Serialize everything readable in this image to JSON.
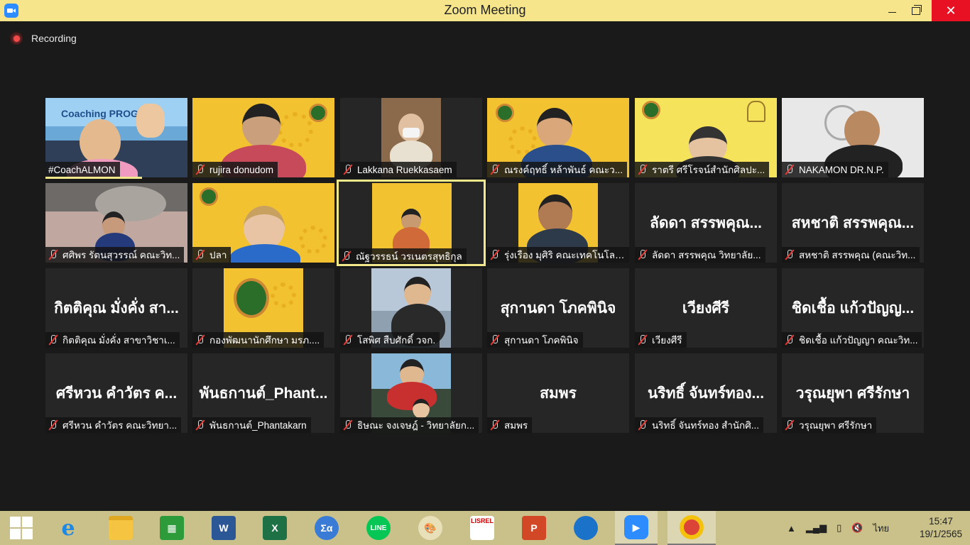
{
  "window": {
    "title": "Zoom Meeting",
    "close_glyph": "✕"
  },
  "recording": {
    "label": "Recording"
  },
  "participants": [
    {
      "name": "#CoachALMON",
      "big": "",
      "muted": false,
      "video": true,
      "overlay": "Coaching PROGRAM"
    },
    {
      "name": "rujira donudom",
      "big": "",
      "muted": true,
      "video": true
    },
    {
      "name": "Lakkana Ruekkasaem",
      "big": "",
      "muted": true,
      "video": true
    },
    {
      "name": "ณรงค์ฤทธิ์ หล้าพันธ์ คณะว...",
      "big": "",
      "muted": true,
      "video": true
    },
    {
      "name": "ราตรี  ศรีโรจน์สำนักศิลปะ...",
      "big": "",
      "muted": true,
      "video": true
    },
    {
      "name": "NAKAMON DR.N.P.",
      "big": "",
      "muted": true,
      "video": true
    },
    {
      "name": "ศศิพร รัตนสุวรรณ์ คณะวิท...",
      "big": "",
      "muted": true,
      "video": true
    },
    {
      "name": "ปลา",
      "big": "",
      "muted": true,
      "video": true
    },
    {
      "name": "ณัฐวรรธน์ วรเนตรสุทธิกุล",
      "big": "",
      "muted": true,
      "video": true
    },
    {
      "name": "รุ่งเรือง มุศิริ คณะเทคโนโลย...",
      "big": "",
      "muted": true,
      "video": true
    },
    {
      "name": "ลัดดา สรรพคุณ  วิทยาลัย...",
      "big": "ลัดดา สรรพคุณ...",
      "muted": true,
      "video": false
    },
    {
      "name": "สหชาติ สรรพคุณ (คณะวิท...",
      "big": "สหชาติ สรรพคุณ...",
      "muted": true,
      "video": false
    },
    {
      "name": "กิตติคุณ  มั่งคั่ง สาขาวิชาเ...",
      "big": "กิตติคุณ  มั่งคั่ง สา...",
      "muted": true,
      "video": false
    },
    {
      "name": "กองพัฒนานักศึกษา มรภ....",
      "big": "",
      "muted": true,
      "video": true
    },
    {
      "name": "โสพิศ สืบศักดิ์ วจก.",
      "big": "",
      "muted": true,
      "video": true
    },
    {
      "name": "สุกานดา โภคพินิจ",
      "big": "สุกานดา โภคพินิจ",
      "muted": true,
      "video": false
    },
    {
      "name": "เวียงศีรี",
      "big": "เวียงศีรี",
      "muted": true,
      "video": false
    },
    {
      "name": "ชิดเชื้อ แก้วปัญญา คณะวิท...",
      "big": "ชิดเชื้อ แก้วปัญญ...",
      "muted": true,
      "video": false
    },
    {
      "name": "ศรีหวน  คำวัตร คณะวิทยา...",
      "big": "ศรีหวน  คำวัตร ค...",
      "muted": true,
      "video": false
    },
    {
      "name": "พันธกานต์_Phantakarn",
      "big": "พันธกานต์_Phant...",
      "muted": true,
      "video": false
    },
    {
      "name": "ธิษณะ จงเจษฎ์ - วิทยาลัยก...",
      "big": "",
      "muted": true,
      "video": true
    },
    {
      "name": "สมพร",
      "big": "สมพร",
      "muted": true,
      "video": false
    },
    {
      "name": "นริทธิ์ จันทร์ทอง สำนักศิ...",
      "big": "นริทธิ์ จันทร์ทอง...",
      "muted": true,
      "video": false
    },
    {
      "name": "วรุณยุพา ศรีรักษา",
      "big": "วรุณยุพา ศรีรักษา",
      "muted": true,
      "video": false
    }
  ],
  "taskbar": {
    "apps": [
      {
        "label": "e",
        "color": "#1e88e5"
      },
      {
        "label": "",
        "color": "#f5c542"
      },
      {
        "label": "",
        "color": "#2e9b3a"
      },
      {
        "label": "W",
        "color": "#2b5797"
      },
      {
        "label": "X",
        "color": "#1e7145"
      },
      {
        "label": "Σα",
        "color": "#3a7bd5"
      },
      {
        "label": "LINE",
        "color": "#06c755"
      },
      {
        "label": "",
        "color": "#d9d4b0"
      },
      {
        "label": "LISREL",
        "color": "#ffffff"
      },
      {
        "label": "P",
        "color": "#d24726"
      },
      {
        "label": "",
        "color": "#1a73c9"
      },
      {
        "label": "",
        "color": "#2d8cff"
      },
      {
        "label": "",
        "color": "#db4437"
      }
    ],
    "language": "ไทย",
    "time": "15:47",
    "date": "19/1/2565"
  },
  "colors": {
    "titlebar": "#f6e58a",
    "taskbar": "#c9c08a",
    "active_border": "#f0e88a",
    "close": "#e81123"
  }
}
